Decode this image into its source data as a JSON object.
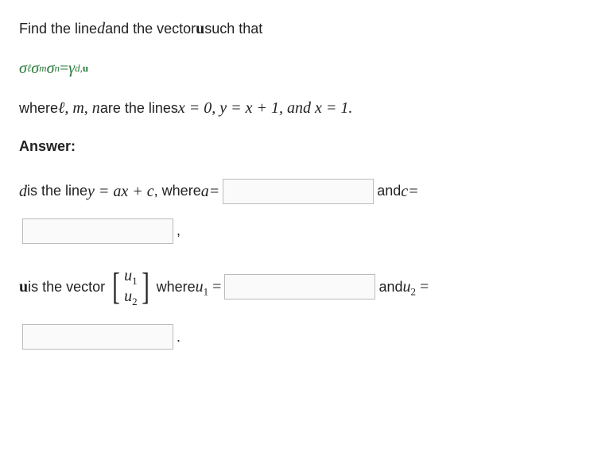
{
  "q": {
    "line1_a": "Find the line ",
    "line1_d": "d",
    "line1_b": " and the vector ",
    "line1_u": "u",
    "line1_c": " such that",
    "eq_lhs_sigma1": "σ",
    "eq_lhs_sub1": "ℓ",
    "eq_lhs_sigma2": "σ",
    "eq_lhs_sub2": "m",
    "eq_lhs_sigma3": "σ",
    "eq_lhs_sub3": "n",
    "eq_eq": " = ",
    "eq_rhs_gamma": "γ",
    "eq_rhs_sub": "d,",
    "eq_rhs_sub_u": "u",
    "line3_a": "where ",
    "line3_lmn": "ℓ, m, n",
    "line3_b": " are the lines ",
    "line3_eq1": "x = 0, y = x + 1,  and x = 1.",
    "answer_label": "Answer:",
    "d_a": "d",
    "d_b": " is the line ",
    "d_eq": "y = ax + c",
    "d_c": ", where ",
    "d_aeq": "a=",
    "d_and": " and ",
    "d_ceq": "c=",
    "comma": ",",
    "u_a": "u",
    "u_b": " is the vector ",
    "u1": "u",
    "u1s": "1",
    "u2": "u",
    "u2s": "2",
    "u_where": " where ",
    "u_u1eq_a": "u",
    "u_u1eq_s": "1",
    "u_u1eq_eq": " = ",
    "u_and": " and ",
    "u_u2eq_a": "u",
    "u_u2eq_s": "2",
    "u_u2eq_eq": " = ",
    "period": "."
  }
}
